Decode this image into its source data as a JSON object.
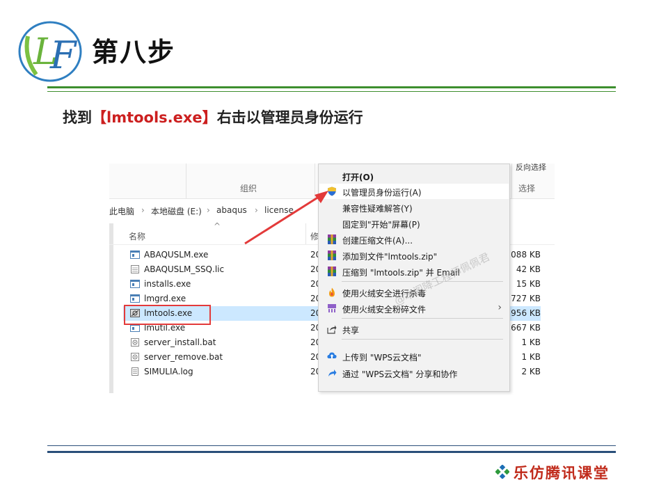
{
  "slide": {
    "logo_text": "LF",
    "step_title": "第八步",
    "instruction": {
      "prefix": "找到",
      "highlight": "【lmtools.exe】",
      "suffix": "右击以管理员身份运行"
    },
    "brand": "乐仿腾讯课堂",
    "colors": {
      "green_rule": "#3d8f2e",
      "blue_rule": "#2a4f7a",
      "highlight_red": "#cc1f1f",
      "brand_red": "#c02a1a"
    }
  },
  "explorer": {
    "ribbon": {
      "group_organize": "组织",
      "group_select": "选择",
      "frag_right": "反向选择"
    },
    "breadcrumb": [
      "此电脑",
      "本地磁盘 (E:)",
      "abaqus",
      "license"
    ],
    "column_name": "名称",
    "column_modified_frag": "修",
    "files": [
      {
        "name": "ABAQUSLM.exe",
        "date": "20",
        "size": "1,088 KB",
        "icon": "exe-icon"
      },
      {
        "name": "ABAQUSLM_SSQ.lic",
        "date": "20",
        "size": "42 KB",
        "icon": "file-icon"
      },
      {
        "name": "installs.exe",
        "date": "20",
        "size": "15 KB",
        "icon": "exe-icon"
      },
      {
        "name": "lmgrd.exe",
        "date": "20",
        "size": "1,727 KB",
        "icon": "exe-icon"
      },
      {
        "name": "lmtools.exe",
        "date": "20",
        "size": "1,956 KB",
        "icon": "lmtools-icon",
        "selected": true
      },
      {
        "name": "lmutil.exe",
        "date": "20",
        "size": "1,667 KB",
        "icon": "exe-icon"
      },
      {
        "name": "server_install.bat",
        "date": "20",
        "size": "1 KB",
        "icon": "bat-icon"
      },
      {
        "name": "server_remove.bat",
        "date": "20",
        "size": "1 KB",
        "icon": "bat-icon"
      },
      {
        "name": "SIMULIA.log",
        "date": "20",
        "size": "2 KB",
        "icon": "log-icon"
      }
    ]
  },
  "context_menu": {
    "items": [
      {
        "label": "打开(O)",
        "bold": true,
        "icon": ""
      },
      {
        "label": "以管理员身份运行(A)",
        "icon": "uac-shield-icon",
        "hover": true
      },
      {
        "label": "兼容性疑难解答(Y)",
        "icon": ""
      },
      {
        "label": "固定到\"开始\"屏幕(P)",
        "icon": ""
      },
      {
        "label": "创建压缩文件(A)...",
        "icon": "winrar-icon"
      },
      {
        "label": "添加到文件\"lmtools.zip\"",
        "icon": "winrar-icon"
      },
      {
        "label": "压缩到 \"lmtools.zip\" 并 Email",
        "icon": "winrar-icon"
      },
      {
        "label": "使用火绒安全进行杀毒",
        "icon": "huorong-flame-icon"
      },
      {
        "label": "使用火绒安全粉碎文件",
        "icon": "huorong-shred-icon",
        "submenu": true
      },
      {
        "label": "共享",
        "icon": "share-icon"
      },
      {
        "label": "上传到 \"WPS云文档\"",
        "icon": "wps-upload-icon"
      },
      {
        "label": "通过 \"WPS云文档\" 分享和协作",
        "icon": "wps-share-icon"
      }
    ],
    "watermark": "@本阁降工程师佩佩君"
  }
}
